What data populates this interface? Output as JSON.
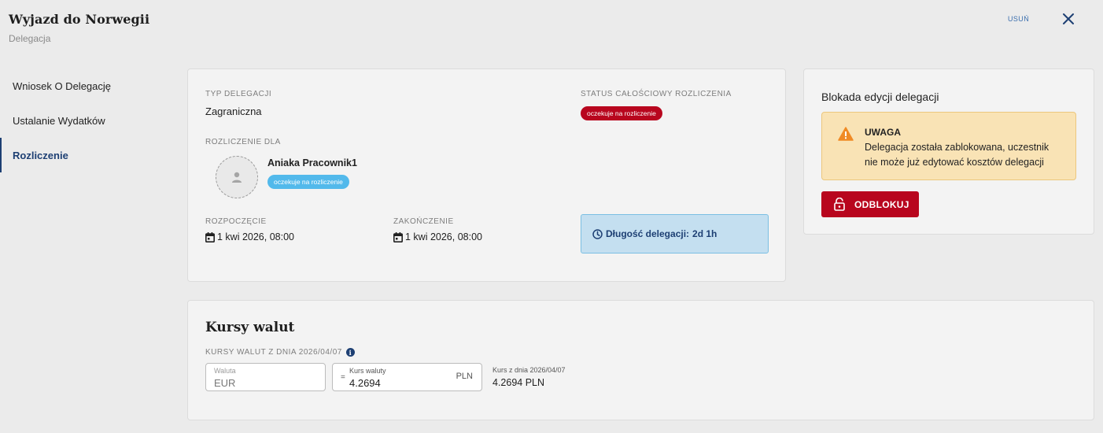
{
  "header": {
    "title": "Wyjazd do Norwegii",
    "subtitle": "Delegacja",
    "delete_label": "USUŃ"
  },
  "sidebar": {
    "items": [
      {
        "label": "Wniosek O Delegację"
      },
      {
        "label": "Ustalanie Wydatków"
      },
      {
        "label": "Rozliczenie"
      }
    ]
  },
  "main": {
    "type_label": "TYP DELEGACJI",
    "type_value": "Zagraniczna",
    "status_label": "STATUS CAŁOŚCIOWY ROZLICZENIA",
    "status_value": "oczekuje na rozliczenie",
    "settlement_for_label": "ROZLICZENIE DLA",
    "person_name": "Aniaka Pracownik1",
    "person_status": "oczekuje na rozliczenie",
    "start_label": "ROZPOCZĘCIE",
    "start_value": "1 kwi 2026, 08:00",
    "end_label": "ZAKOŃCZENIE",
    "end_value": "1 kwi 2026, 08:00",
    "duration_label": "Długość delegacji:",
    "duration_value": "2d 1h"
  },
  "block": {
    "title": "Blokada edycji delegacji",
    "warning_head": "UWAGA",
    "warning_text": "Delegacja została zablokowana, uczestnik nie może już edytować kosztów delegacji",
    "unlock_label": "ODBLOKUJ"
  },
  "rates": {
    "title": "Kursy walut",
    "subtitle": "KURSY WALUT Z DNIA 2026/04/07",
    "currency_label": "Waluta",
    "currency_value": "EUR",
    "equals": "=",
    "rate_label": "Kurs waluty",
    "rate_value": "4.2694",
    "rate_unit": "PLN",
    "ref_label": "Kurs z dnia 2026/04/07",
    "ref_value": "4.2694 PLN"
  },
  "colors": {
    "accent": "#1d3f73",
    "danger": "#b8061e",
    "info_badge": "#52b9eb",
    "warning_bg": "#f9e3b5"
  }
}
